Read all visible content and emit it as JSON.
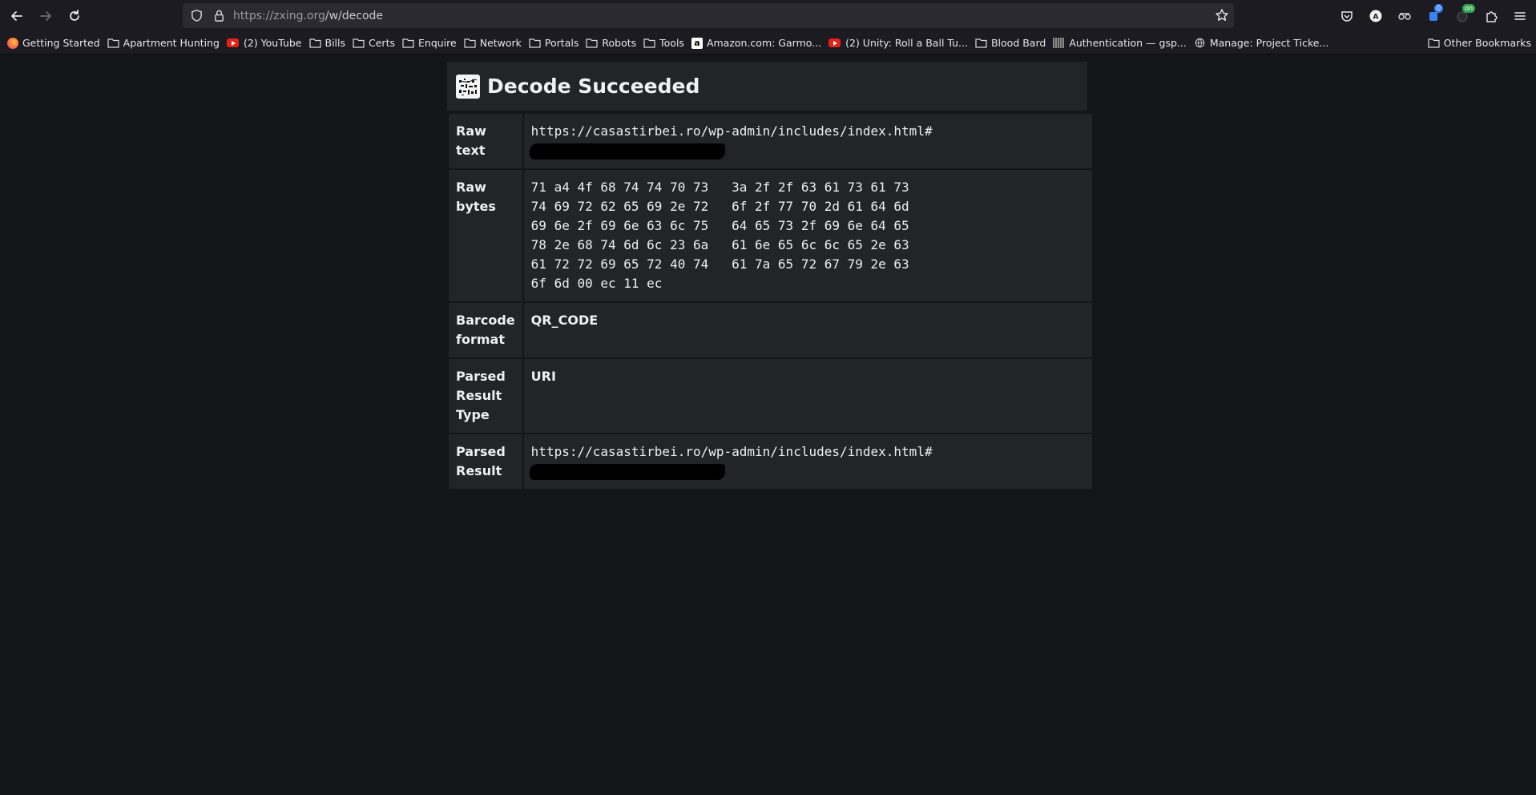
{
  "browser": {
    "url_host": "https://zxing.org",
    "url_path": "/w/decode",
    "bookmarks": [
      {
        "icon": "firefox-icon",
        "label": "Getting Started"
      },
      {
        "icon": "folder-icon",
        "label": "Apartment Hunting"
      },
      {
        "icon": "youtube-icon",
        "label": "(2) YouTube"
      },
      {
        "icon": "folder-icon",
        "label": "Bills"
      },
      {
        "icon": "folder-icon",
        "label": "Certs"
      },
      {
        "icon": "folder-icon",
        "label": "Enquire"
      },
      {
        "icon": "folder-icon",
        "label": "Network"
      },
      {
        "icon": "folder-icon",
        "label": "Portals"
      },
      {
        "icon": "folder-icon",
        "label": "Robots"
      },
      {
        "icon": "folder-icon",
        "label": "Tools"
      },
      {
        "icon": "amazon-icon",
        "label": "Amazon.com: Garmo..."
      },
      {
        "icon": "youtube-icon",
        "label": "(2) Unity: Roll a Ball Tu..."
      },
      {
        "icon": "folder-icon",
        "label": "Blood Bard"
      },
      {
        "icon": "auth-icon",
        "label": "Authentication — gsp..."
      },
      {
        "icon": "globe-icon",
        "label": "Manage: Project Ticke..."
      }
    ],
    "other_bookmarks": "Other Bookmarks",
    "extension_badges": {
      "account": "A",
      "counter": "0",
      "toggle": "on"
    }
  },
  "page": {
    "title": "Decode Succeeded",
    "rows": [
      {
        "label": "Raw text",
        "value": "https://casastirbei.ro/wp-admin/includes/index.html#",
        "redacted": true
      },
      {
        "label": "Raw bytes",
        "value": "71 a4 4f 68 74 74 70 73   3a 2f 2f 63 61 73 61 73\n74 69 72 62 65 69 2e 72   6f 2f 77 70 2d 61 64 6d\n69 6e 2f 69 6e 63 6c 75   64 65 73 2f 69 6e 64 65\n78 2e 68 74 6d 6c 23 6a   61 6e 65 6c 6c 65 2e 63\n61 72 72 69 65 72 40 74   61 7a 65 72 67 79 2e 63\n6f 6d 00 ec 11 ec"
      },
      {
        "label": "Barcode format",
        "value": "QR_CODE"
      },
      {
        "label": "Parsed Result Type",
        "value": "URI"
      },
      {
        "label": "Parsed Result",
        "value": "https://casastirbei.ro/wp-admin/includes/index.html#",
        "redacted": true
      }
    ]
  }
}
